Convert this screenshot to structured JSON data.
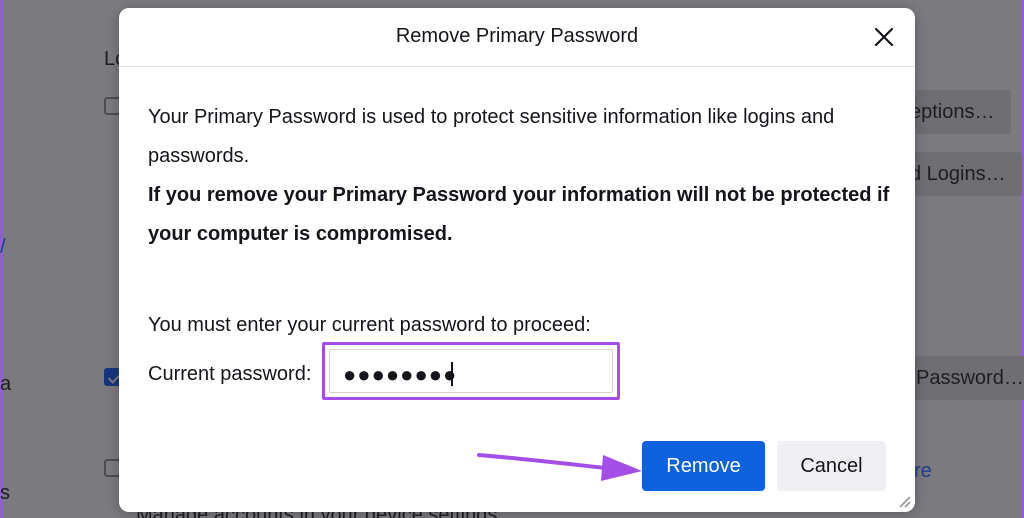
{
  "background": {
    "heading_fragment": "Lo",
    "exceptions_button": "eptions…",
    "saved_logins_button": "d Logins…",
    "change_password_button": "Password…",
    "link_fragment": "/",
    "left_text_a": "a",
    "left_text_s": "s",
    "learn_more_fragment": "re",
    "bottom_text": "Manage accounts in your device settings"
  },
  "dialog": {
    "title": "Remove Primary Password",
    "description": "Your Primary Password is used to protect sensitive information like logins and passwords.",
    "warning": "If you remove your Primary Password your information will not be protected if your computer is compromised.",
    "proceed_text": "You must enter your current password to proceed:",
    "password_label": "Current password:",
    "password_value": "●●●●●●●●",
    "remove_label": "Remove",
    "cancel_label": "Cancel"
  },
  "colors": {
    "accent": "#0b61de",
    "highlight": "#a44ee8"
  }
}
